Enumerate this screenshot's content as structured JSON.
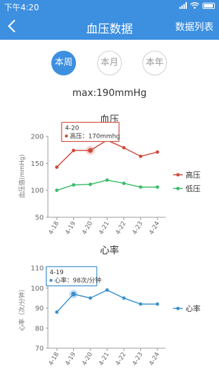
{
  "status_bar": {
    "time": "下午4:20"
  },
  "nav": {
    "title": "血压数据",
    "action": "数据列表"
  },
  "tabs": [
    {
      "label": "本周",
      "active": true
    },
    {
      "label": "本月",
      "active": false
    },
    {
      "label": "本年",
      "active": false
    }
  ],
  "max_text": "max:190mmHg",
  "colors": {
    "primary": "#3d8fe0",
    "high": "#d04a3c",
    "low": "#3bbd6a",
    "heart": "#3a91cc"
  },
  "chart_data": [
    {
      "type": "line",
      "title": "血压",
      "ylabel": "血压值(mmHg)",
      "xlabel": "",
      "categories": [
        "4-18",
        "4-19",
        "4-20",
        "4-21",
        "4-22",
        "4-23",
        "4-24"
      ],
      "ylim": [
        50,
        200
      ],
      "yticks": [
        50,
        100,
        150,
        200
      ],
      "legend_position": "right",
      "series": [
        {
          "name": "高压",
          "values": [
            143,
            174,
            174,
            193,
            179,
            163,
            171
          ]
        },
        {
          "name": "低压",
          "values": [
            100,
            110,
            111,
            119,
            113,
            106,
            106
          ]
        }
      ],
      "tooltip": {
        "category": "4-20",
        "series": "高压",
        "value_text": "170mmhg",
        "label": "高压"
      }
    },
    {
      "type": "line",
      "title": "心率",
      "ylabel": "心率（次/分钟）",
      "xlabel": "",
      "categories": [
        "4-18",
        "4-19",
        "4-20",
        "4-21",
        "4-22",
        "4-23",
        "4-24"
      ],
      "ylim": [
        70,
        110
      ],
      "yticks": [
        70,
        80,
        90,
        100,
        110
      ],
      "legend_position": "right",
      "series": [
        {
          "name": "心率",
          "values": [
            88,
            97,
            95,
            99,
            95,
            92,
            92
          ]
        }
      ],
      "tooltip": {
        "category": "4-19",
        "series": "心率",
        "value_text": "98次/分钟",
        "label": "心率"
      }
    }
  ]
}
